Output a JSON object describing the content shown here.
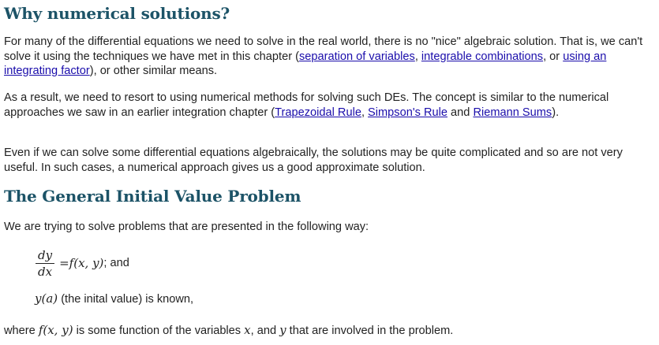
{
  "headings": {
    "why": "Why numerical solutions?",
    "ivp": "The General Initial Value Problem"
  },
  "para1": {
    "text_a": "For many of the differential equations we need to solve in the real world, there is no \"nice\" algebraic solution. That is, we can't solve it using the techniques we have met in this chapter (",
    "link_separation": "separation of variables",
    "sep_1": ", ",
    "link_integrable": "integrable combinations",
    "sep_2": ", or ",
    "link_integrating": "using an integrating factor",
    "text_b": "), or other similar means."
  },
  "para2": {
    "text_a": "As a result, we need to resort to using numerical methods for solving such DEs. The concept is similar to the numerical approaches we saw in an earlier integration chapter (",
    "link_trapezoidal": "Trapezoidal Rule",
    "sep_1": ", ",
    "link_simpson": "Simpson's Rule",
    "sep_2": " and ",
    "link_riemann": "Riemann Sums",
    "text_b": ")."
  },
  "para3": {
    "text": "Even if we can solve some differential equations algebraically, the solutions may be quite complicated and so are not very useful. In such cases, a numerical approach gives us a good approximate solution."
  },
  "para4": {
    "text": "We are trying to solve problems that are presented in the following way:"
  },
  "equation": {
    "numerator": "dy",
    "denominator": "dx",
    "equals": " = ",
    "rhs_f": "f",
    "rhs_args": "(x, y)",
    "suffix": "; and"
  },
  "condition": {
    "math_y": "y",
    "math_a": "(a)",
    "text": " (the inital value) is known,"
  },
  "para5": {
    "text_a": "where ",
    "math_f": "f",
    "math_args": "(x, y)",
    "text_b": " is some function of the variables ",
    "math_x": "x",
    "text_c": ", and ",
    "math_y": "y",
    "text_d": " that are involved in the problem."
  }
}
